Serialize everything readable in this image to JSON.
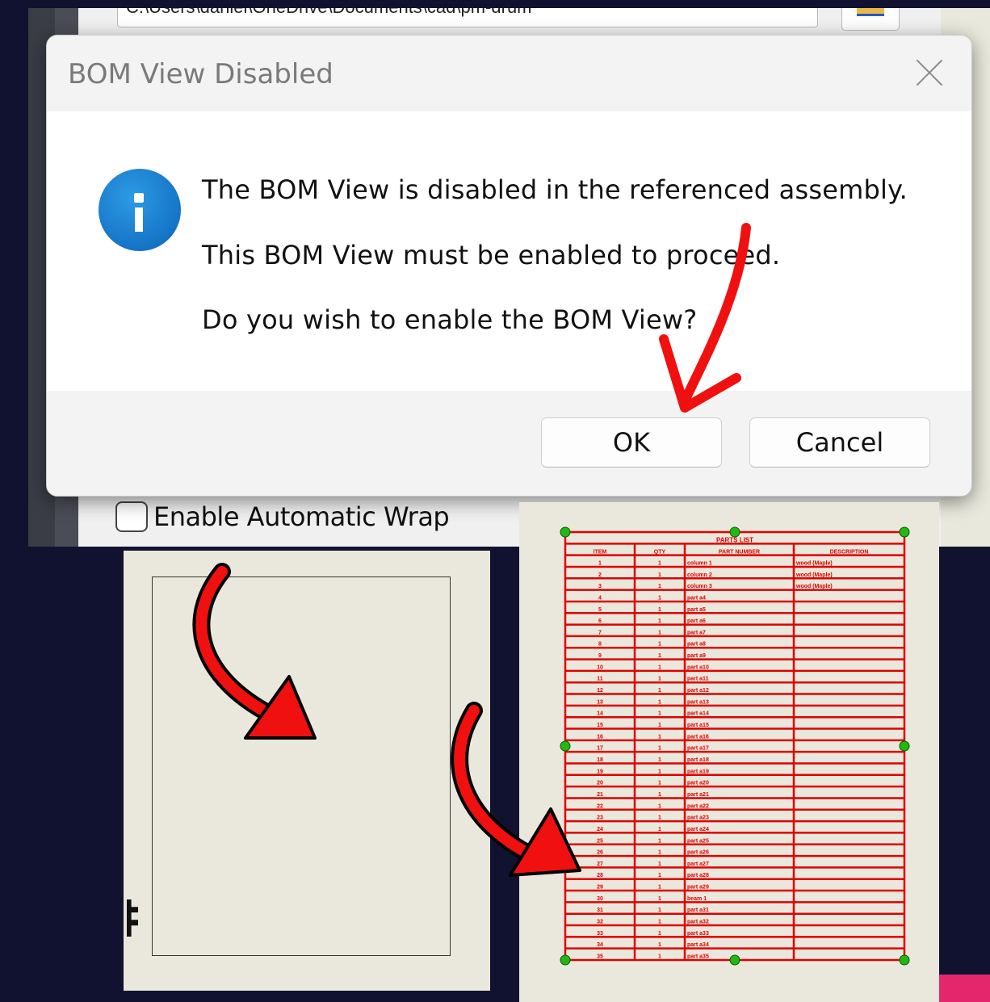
{
  "background": {
    "path_text": "C:\\Users\\daniel\\OneDrive\\Documents\\cad\\pm-drum",
    "checkbox_label": "Enable Automatic Wrap",
    "checkbox_checked": false
  },
  "dialog": {
    "title": "BOM View Disabled",
    "icon": "info-icon",
    "message_line1": "The BOM View is disabled in the referenced assembly.",
    "message_line2": "This BOM View must be enabled to proceed.",
    "message_line3": "Do you wish to enable the BOM View?",
    "ok_label": "OK",
    "cancel_label": "Cancel"
  },
  "parts_list": {
    "title": "PARTS LIST",
    "headers": [
      "ITEM",
      "QTY",
      "PART NUMBER",
      "DESCRIPTION"
    ],
    "rows": [
      [
        "1",
        "1",
        "column 1",
        "wood (Maple)"
      ],
      [
        "2",
        "1",
        "column 2",
        "wood (Maple)"
      ],
      [
        "3",
        "1",
        "column 3",
        "wood (Maple)"
      ],
      [
        "4",
        "1",
        "part a4",
        ""
      ],
      [
        "5",
        "1",
        "part a5",
        ""
      ],
      [
        "6",
        "1",
        "part a6",
        ""
      ],
      [
        "7",
        "1",
        "part a7",
        ""
      ],
      [
        "8",
        "1",
        "part a8",
        ""
      ],
      [
        "9",
        "1",
        "part a9",
        ""
      ],
      [
        "10",
        "1",
        "part a10",
        ""
      ],
      [
        "11",
        "1",
        "part a11",
        ""
      ],
      [
        "12",
        "1",
        "part a12",
        ""
      ],
      [
        "13",
        "1",
        "part a13",
        ""
      ],
      [
        "14",
        "1",
        "part a14",
        ""
      ],
      [
        "15",
        "1",
        "part a15",
        ""
      ],
      [
        "16",
        "1",
        "part a16",
        ""
      ],
      [
        "17",
        "1",
        "part a17",
        ""
      ],
      [
        "18",
        "1",
        "part a18",
        ""
      ],
      [
        "19",
        "1",
        "part a19",
        ""
      ],
      [
        "20",
        "1",
        "part a20",
        ""
      ],
      [
        "21",
        "1",
        "part a21",
        ""
      ],
      [
        "22",
        "1",
        "part a22",
        ""
      ],
      [
        "23",
        "1",
        "part a23",
        ""
      ],
      [
        "24",
        "1",
        "part a24",
        ""
      ],
      [
        "25",
        "1",
        "part a25",
        ""
      ],
      [
        "26",
        "1",
        "part a26",
        ""
      ],
      [
        "27",
        "1",
        "part a27",
        ""
      ],
      [
        "28",
        "1",
        "part a28",
        ""
      ],
      [
        "29",
        "1",
        "part a29",
        ""
      ],
      [
        "30",
        "1",
        "beam 1",
        ""
      ],
      [
        "31",
        "1",
        "part a31",
        ""
      ],
      [
        "32",
        "1",
        "part a32",
        ""
      ],
      [
        "33",
        "1",
        "part a33",
        ""
      ],
      [
        "34",
        "1",
        "part a34",
        ""
      ],
      [
        "35",
        "1",
        "part a35",
        ""
      ]
    ]
  },
  "colors": {
    "backdrop": "#10122f",
    "table_red": "#e00000",
    "arrow_red": "#f01010",
    "handle_green": "#22b814",
    "sheet_beige": "#eae8dc"
  }
}
